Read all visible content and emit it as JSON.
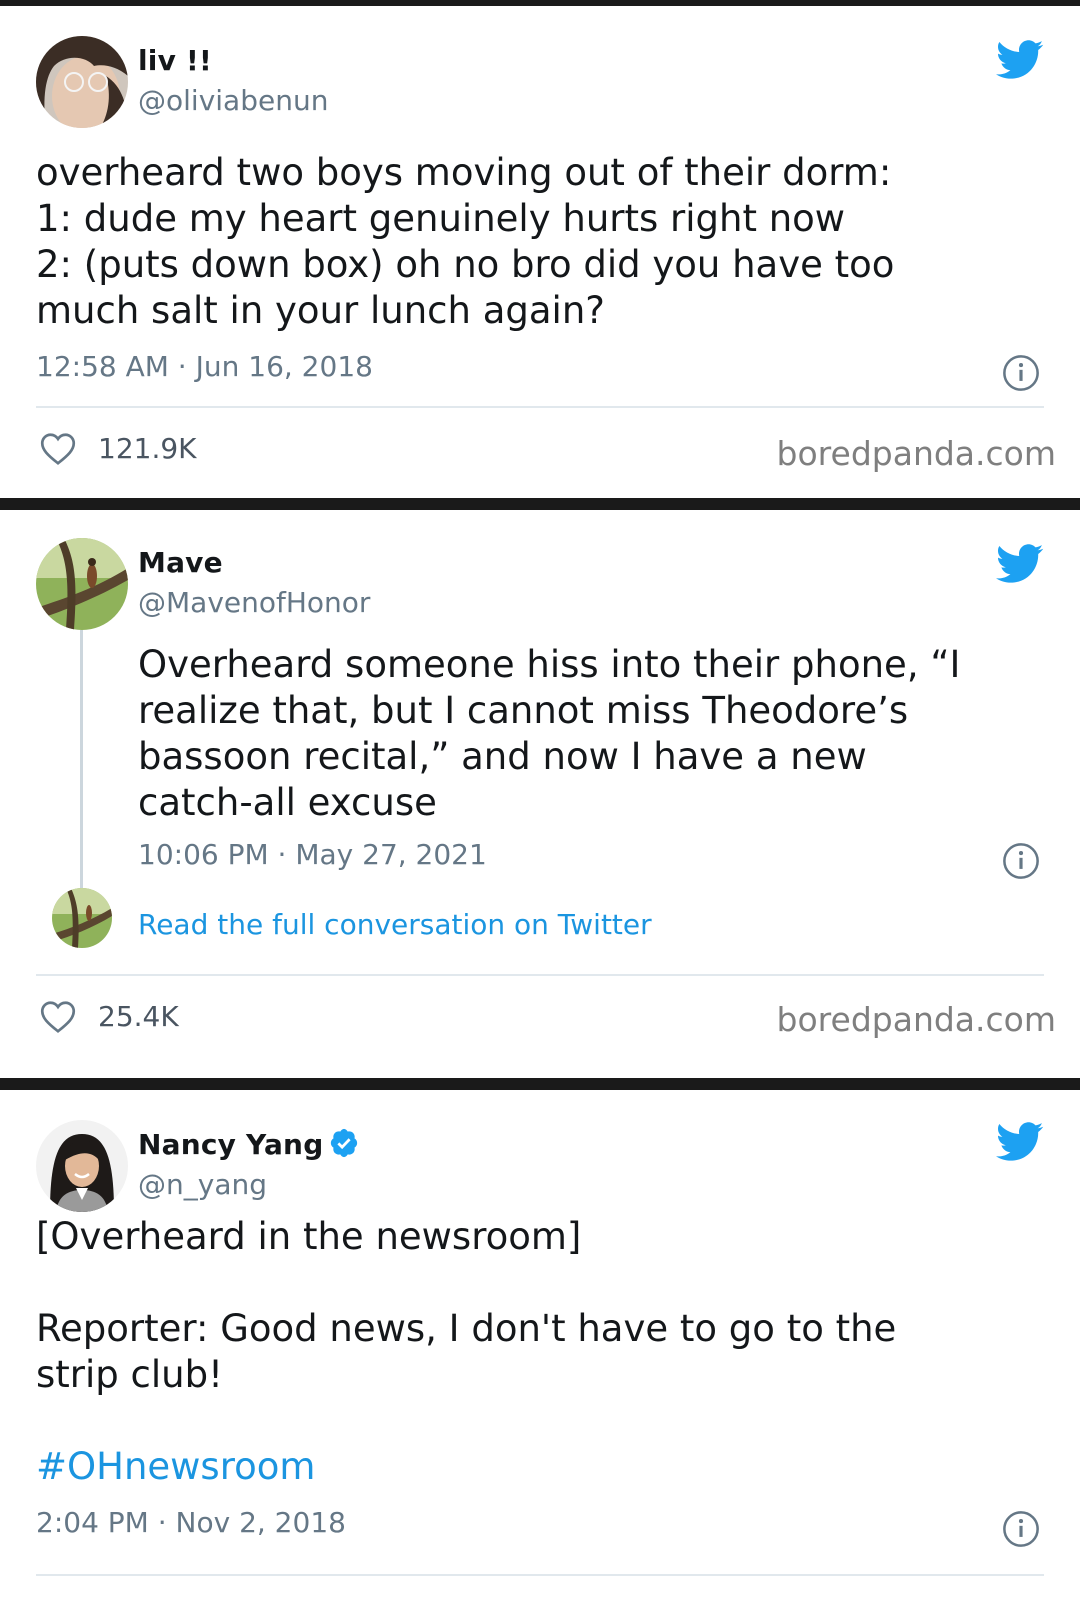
{
  "tweets": [
    {
      "name": "liv !!",
      "handle": "@oliviabenun",
      "text": "overheard two boys moving out of their dorm:\n1: dude my heart genuinely hurts right now\n2: (puts down box) oh no bro did you have too\nmuch salt in your lunch again?",
      "time": "12:58 AM · Jun 16, 2018",
      "likes": "121.9K",
      "watermark": "boredpanda.com"
    },
    {
      "name": "Mave",
      "handle": "@MavenofHonor",
      "text": "Overheard someone hiss into their phone, “I\nrealize that, but I cannot miss Theodore’s\nbassoon recital,” and now I have a new\ncatch-all excuse",
      "time": "10:06 PM · May 27, 2021",
      "read_full": "Read the full conversation on Twitter",
      "likes": "25.4K",
      "watermark": "boredpanda.com"
    },
    {
      "name": "Nancy Yang",
      "handle": "@n_yang",
      "text_line1": "[Overheard in the newsroom]",
      "text_line2": "Reporter: Good news, I don't have to go to the\nstrip club!",
      "hashtag": "#OHnewsroom",
      "time": "2:04 PM · Nov 2, 2018"
    }
  ],
  "colors": {
    "twitter_blue": "#1da1f2",
    "link_blue": "#1b95e0",
    "secondary_text": "#657786"
  },
  "icons": [
    "twitter-bird-icon",
    "info-icon",
    "heart-icon",
    "verified-badge-icon"
  ]
}
